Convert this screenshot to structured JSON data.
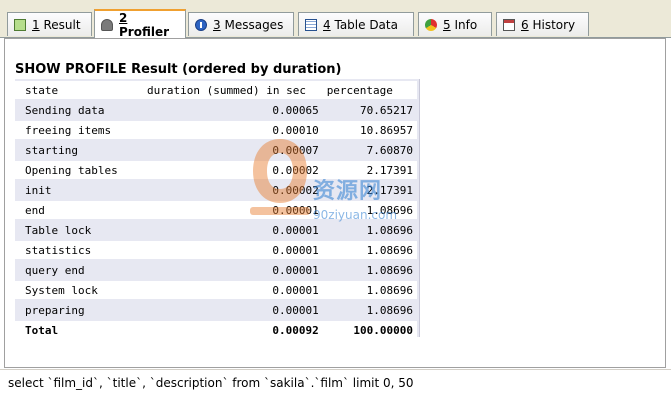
{
  "tabs": [
    {
      "num": "1",
      "label": "Result",
      "icon": "result-icon"
    },
    {
      "num": "2",
      "label": "Profiler",
      "icon": "profiler-icon"
    },
    {
      "num": "3",
      "label": "Messages",
      "icon": "messages-icon"
    },
    {
      "num": "4",
      "label": "Table Data",
      "icon": "table-data-icon"
    },
    {
      "num": "5",
      "label": "Info",
      "icon": "info-icon"
    },
    {
      "num": "6",
      "label": "History",
      "icon": "history-icon"
    }
  ],
  "active_tab": "2 Profiler",
  "profile": {
    "title": "SHOW PROFILE Result (ordered by duration)",
    "headers": [
      "state",
      "duration (summed) in sec",
      "percentage"
    ],
    "rows": [
      [
        "Sending data",
        "0.00065",
        "70.65217"
      ],
      [
        "freeing items",
        "0.00010",
        "10.86957"
      ],
      [
        "starting",
        "0.00007",
        "7.60870"
      ],
      [
        "Opening tables",
        "0.00002",
        "2.17391"
      ],
      [
        "init",
        "0.00002",
        "2.17391"
      ],
      [
        "end",
        "0.00001",
        "1.08696"
      ],
      [
        "Table lock",
        "0.00001",
        "1.08696"
      ],
      [
        "statistics",
        "0.00001",
        "1.08696"
      ],
      [
        "query end",
        "0.00001",
        "1.08696"
      ],
      [
        "System lock",
        "0.00001",
        "1.08696"
      ],
      [
        "preparing",
        "0.00001",
        "1.08696"
      ]
    ],
    "total": [
      "Total",
      "0.00092",
      "100.00000"
    ]
  },
  "watermark": {
    "text": "资源网",
    "sub": "90ziyuan.com"
  },
  "query": "select `film_id`, `title`, `description` from `sakila`.`film` limit 0, 50"
}
